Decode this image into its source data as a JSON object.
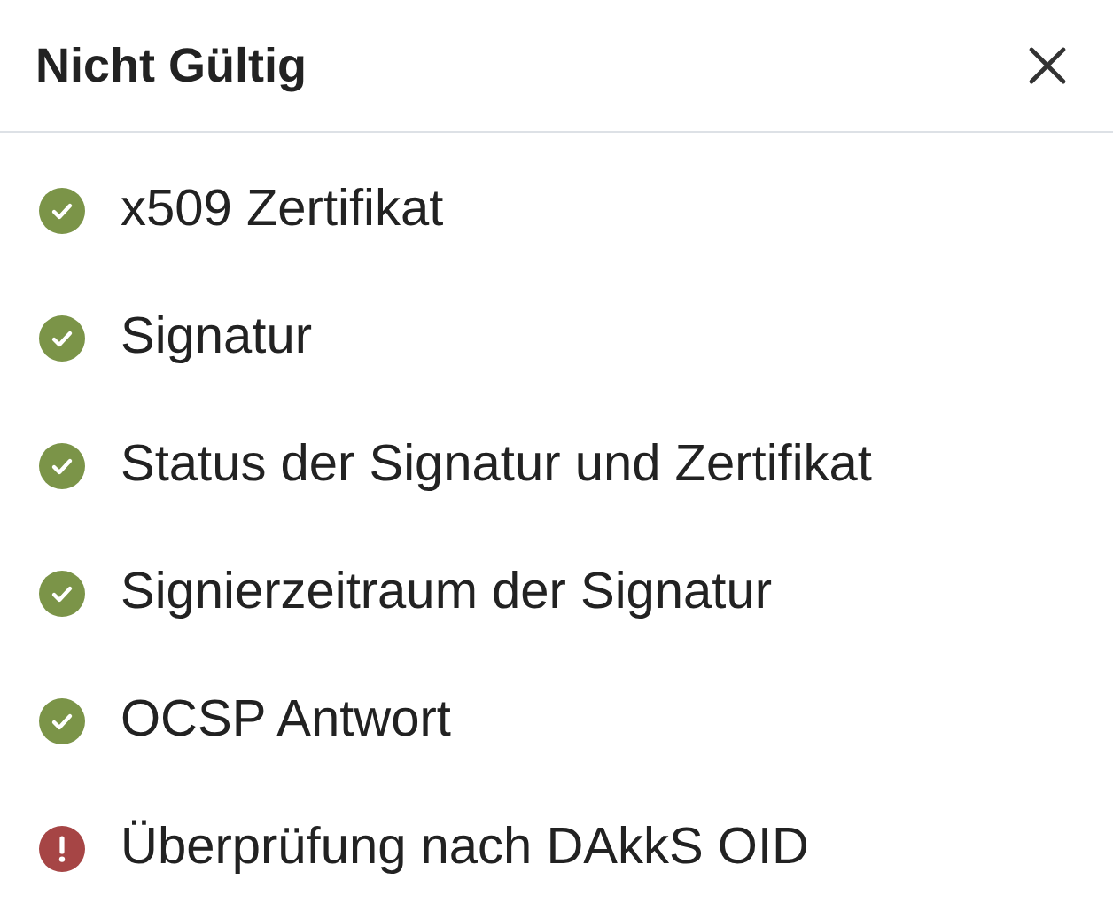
{
  "dialog": {
    "title": "Nicht Gültig"
  },
  "checks": [
    {
      "label": "x509 Zertifikat",
      "kind": "passed"
    },
    {
      "label": "Signatur",
      "kind": "passed"
    },
    {
      "label": "Status der Signatur und Zertifikat",
      "kind": "passed"
    },
    {
      "label": "Signierzeitraum der Signatur",
      "kind": "passed"
    },
    {
      "label": "OCSP Antwort",
      "kind": "passed"
    },
    {
      "label": "Überprüfung nach DAkkS OID",
      "kind": "failed"
    }
  ]
}
